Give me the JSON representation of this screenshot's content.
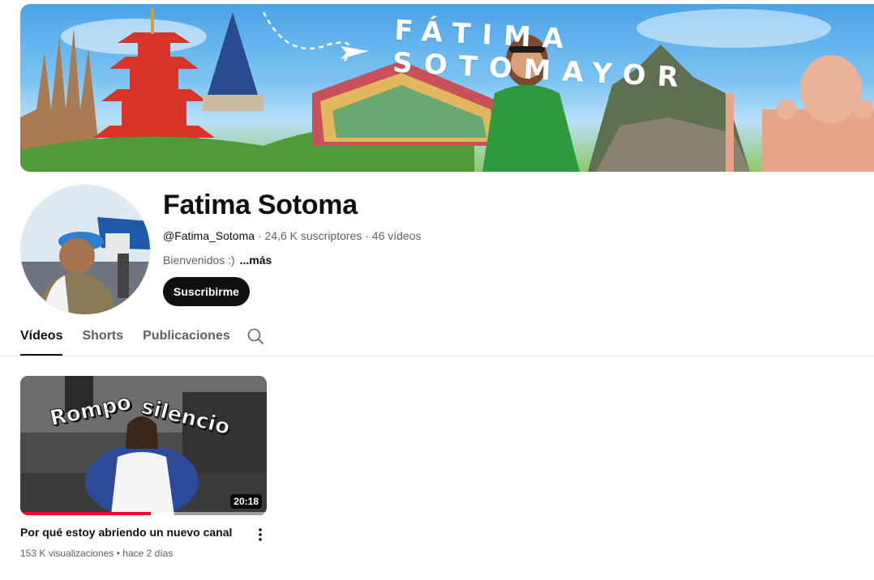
{
  "banner": {
    "title": "FÁTIMA SOTOMAYOR",
    "image": "travel-collage-banner"
  },
  "channel": {
    "name": "Fatima Sotoma",
    "handle": "@Fatima_Sotoma",
    "separator": "·",
    "subscribers": "24,6 K suscriptores",
    "video_count": "46 vídeos",
    "description": "Bienvenidos :)",
    "more_label": "...más",
    "subscribe_label": "Suscribirme",
    "avatar_icon": "avatar-photo"
  },
  "tabs": [
    {
      "label": "Vídeos",
      "active": true
    },
    {
      "label": "Shorts",
      "active": false
    },
    {
      "label": "Publicaciones",
      "active": false
    }
  ],
  "search_icon": "search-icon",
  "videos": [
    {
      "thumbnail_text_1": "Rompo",
      "thumbnail_text_2": "silencio",
      "duration": "20:18",
      "watch_progress": 0.53,
      "title": "Por qué estoy abriendo un nuevo canal",
      "views": "153 K visualizaciones",
      "separator": "•",
      "age": "hace 2 días",
      "menu_icon": "more-vert-icon"
    }
  ],
  "colors": {
    "accent": "#0f0f0f",
    "progress": "#ff0033",
    "secondary_text": "#606060"
  }
}
